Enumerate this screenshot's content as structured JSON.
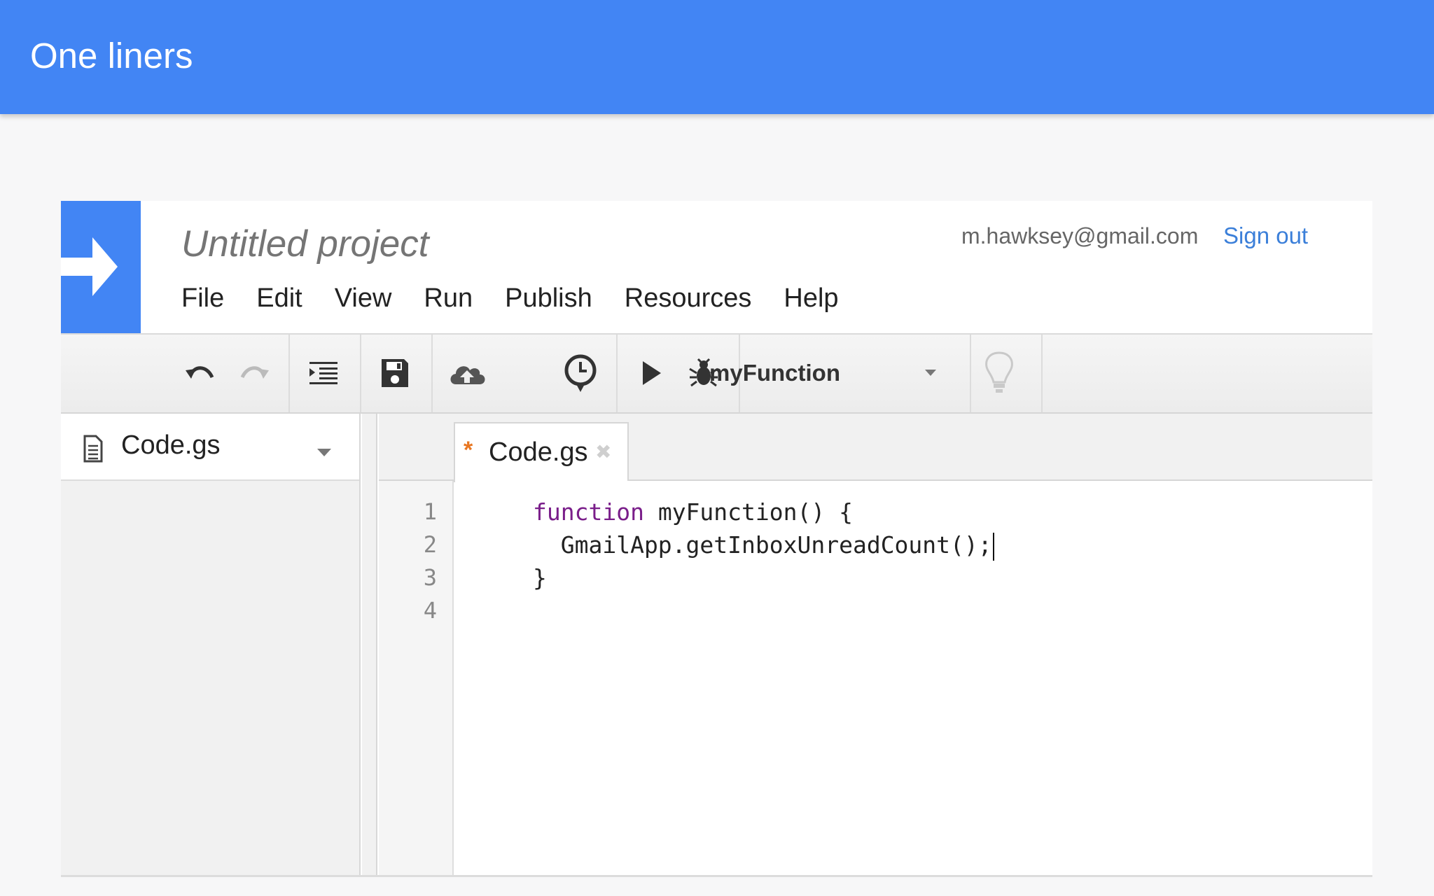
{
  "slide": {
    "title": "One liners"
  },
  "project": {
    "title": "Untitled project"
  },
  "account": {
    "email": "m.hawksey@gmail.com",
    "sign_out": "Sign out"
  },
  "menu": [
    "File",
    "Edit",
    "View",
    "Run",
    "Publish",
    "Resources",
    "Help"
  ],
  "toolbar": {
    "icons": [
      "undo-icon",
      "redo-icon",
      "indent-icon",
      "save-icon",
      "deploy-cloud-icon",
      "triggers-clock-icon",
      "run-play-icon",
      "debug-bug-icon",
      "lightbulb-icon"
    ],
    "function_select": "myFunction"
  },
  "files": [
    {
      "name": "Code.gs"
    }
  ],
  "tab": {
    "modified_marker": "*",
    "label": "Code.gs",
    "close": "✖"
  },
  "editor": {
    "line_numbers": [
      "1",
      "2",
      "3",
      "4"
    ],
    "lines": [
      {
        "keyword": "function",
        "rest": " myFunction() {"
      },
      {
        "keyword": "",
        "rest": "  GmailApp.getInboxUnreadCount();"
      },
      {
        "keyword": "",
        "rest": "}"
      },
      {
        "keyword": "",
        "rest": ""
      }
    ]
  },
  "colors": {
    "brand_blue": "#4285f4",
    "link_blue": "#3b7fd9",
    "keyword_purple": "#7a1e8a",
    "modified_orange": "#e87722"
  }
}
